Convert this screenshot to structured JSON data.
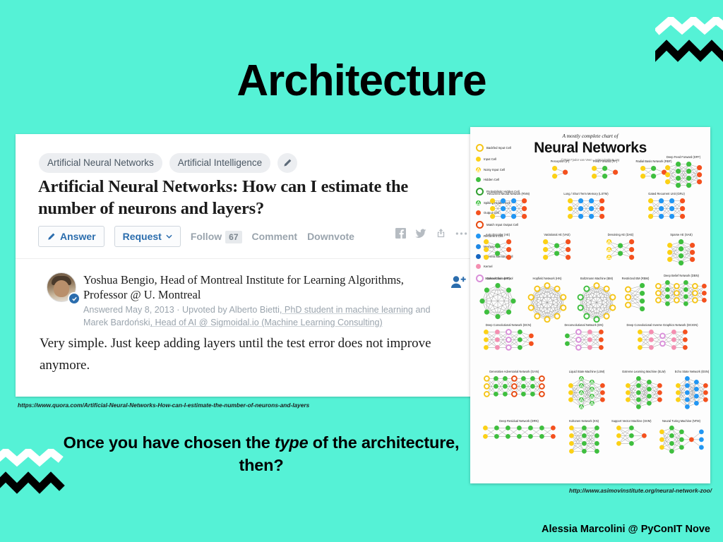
{
  "slide": {
    "title": "Architecture",
    "background_color": "#55f2d6",
    "bottom_question_prefix": "Once you have chosen the ",
    "bottom_question_emphasis": "type",
    "bottom_question_suffix": " of the architecture, then?",
    "footer_credit": "Alessia Marcolini @ PyConIT Nove"
  },
  "quora": {
    "caption_url": "https://www.quora.com/Artificial-Neural-Networks-How-can-I-estimate-the-number-of-neurons-and-layers",
    "topics": [
      "Artificial Neural Networks",
      "Artificial Intelligence"
    ],
    "edit_icon": "pencil-icon",
    "question_title": "Artificial Neural Networks: How can I estimate the number of neurons and layers?",
    "actions": {
      "answer_label": "Answer",
      "request_label": "Request",
      "follow_label": "Follow",
      "follow_count": "67",
      "comment_label": "Comment",
      "downvote_label": "Downvote"
    },
    "social_icons": [
      "facebook-icon",
      "twitter-icon",
      "share-icon",
      "more-options-icon"
    ],
    "answer": {
      "author": "Yoshua Bengio, Head of Montreal Institute for Learning Algorithms, Professor @ U. Montreal",
      "meta_prefix": "Answered May 8, 2013 · Upvoted by ",
      "upvoter_1_name": "Alberto Bietti",
      "upvoter_1_credential": ", PhD student in machine learning",
      "meta_join": " and ",
      "upvoter_2_name": "Marek Bardoński",
      "upvoter_2_credential": ", Head of AI @ Sigmoidal.io (Machine Learning Consulting)",
      "body": "Very simple. Just keep adding layers until the test error does not improve anymore.",
      "follow_author_icon": "add-person-icon"
    }
  },
  "zoo": {
    "caption_url": "http://www.asimovinstitute.org/neural-network-zoo/",
    "supertitle": "A mostly complete chart of",
    "title": "Neural Networks",
    "credit": "©2016 Fjodor van Veen - asimovinstitute.org",
    "legend": [
      {
        "label": "Backfed Input Cell",
        "color": "#f5c518",
        "style": "ring"
      },
      {
        "label": "Input Cell",
        "color": "#fcd116",
        "style": "solid"
      },
      {
        "label": "Noisy Input Cell",
        "color": "#fcd116",
        "style": "triangle"
      },
      {
        "label": "Hidden Cell",
        "color": "#3fbf3f",
        "style": "solid"
      },
      {
        "label": "Probabilistic Hidden Cell",
        "color": "#2f9e2f",
        "style": "ring"
      },
      {
        "label": "Spiking Hidden Cell",
        "color": "#3fbf3f",
        "style": "triangle"
      },
      {
        "label": "Output Cell",
        "color": "#f4511e",
        "style": "solid"
      },
      {
        "label": "Match Input Output Cell",
        "color": "#e8490f",
        "style": "ring"
      },
      {
        "label": "Recurrent Cell",
        "color": "#2196f3",
        "style": "solid"
      },
      {
        "label": "Memory Cell",
        "color": "#1e88e5",
        "style": "solid"
      },
      {
        "label": "Different Memory Cell",
        "color": "#1565c0",
        "style": "solid"
      },
      {
        "label": "Kernel",
        "color": "#f48fb1",
        "style": "solid"
      },
      {
        "label": "Convolution or Pool",
        "color": "#d98fd9",
        "style": "ring"
      }
    ],
    "networks": [
      {
        "name": "Perceptron (P)",
        "row": 1
      },
      {
        "name": "Feed Forward (FF)",
        "row": 1
      },
      {
        "name": "Radial Basis Network (RBF)",
        "row": 1
      },
      {
        "name": "Deep Feed Forward (DFF)",
        "row": 1
      },
      {
        "name": "Recurrent Neural Network (RNN)",
        "row": 2
      },
      {
        "name": "Long / Short Term Memory (LSTM)",
        "row": 2
      },
      {
        "name": "Gated Recurrent Unit (GRU)",
        "row": 2
      },
      {
        "name": "Auto Encoder (AE)",
        "row": 3
      },
      {
        "name": "Variational AE (VAE)",
        "row": 3
      },
      {
        "name": "Denoising AE (DAE)",
        "row": 3
      },
      {
        "name": "Sparse AE (SAE)",
        "row": 3
      },
      {
        "name": "Markov Chain (MC)",
        "row": 4
      },
      {
        "name": "Hopfield Network (HN)",
        "row": 4
      },
      {
        "name": "Boltzmann Machine (BM)",
        "row": 4
      },
      {
        "name": "Restricted BM (RBM)",
        "row": 4
      },
      {
        "name": "Deep Belief Network (DBN)",
        "row": 4
      },
      {
        "name": "Deep Convolutional Network (DCN)",
        "row": 5
      },
      {
        "name": "Deconvolutional Network (DN)",
        "row": 5
      },
      {
        "name": "Deep Convolutional Inverse Graphics Network (DCIGN)",
        "row": 5
      },
      {
        "name": "Generative Adversarial Network (GAN)",
        "row": 6
      },
      {
        "name": "Liquid State Machine (LSM)",
        "row": 6
      },
      {
        "name": "Extreme Learning Machine (ELM)",
        "row": 6
      },
      {
        "name": "Echo State Network (ESN)",
        "row": 6
      },
      {
        "name": "Deep Residual Network (DRN)",
        "row": 7
      },
      {
        "name": "Kohonen Network (KN)",
        "row": 7
      },
      {
        "name": "Support Vector Machine (SVM)",
        "row": 7
      },
      {
        "name": "Neural Turing Machine (NTM)",
        "row": 7
      }
    ]
  }
}
